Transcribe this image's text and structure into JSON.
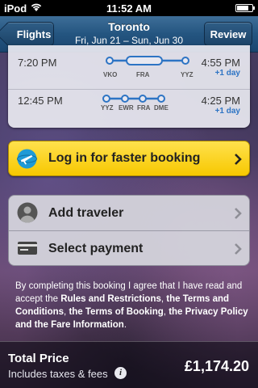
{
  "status_bar": {
    "carrier": "iPod",
    "time": "11:52 AM",
    "battery_level": 0.8
  },
  "nav": {
    "back_label": "Flights",
    "title": "Toronto",
    "subtitle": "Fri, Jun 21 – Sun, Jun 30",
    "review_label": "Review"
  },
  "flights": [
    {
      "departure": "7:20 PM",
      "arrival": "4:55 PM",
      "day_offset": "+1 day",
      "stops": [
        "VKO",
        "FRA",
        "YYZ"
      ]
    },
    {
      "departure": "12:45 PM",
      "arrival": "4:25 PM",
      "day_offset": "+1 day",
      "stops": [
        "YYZ",
        "EWR",
        "FRA",
        "DME"
      ]
    }
  ],
  "login_button": {
    "label": "Log in for faster booking",
    "icon": "globe-plane-icon"
  },
  "actions": {
    "add_traveler": "Add traveler",
    "select_payment": "Select payment"
  },
  "terms": {
    "prefix": "By completing this booking I agree that I have read and accept the ",
    "rules": "Rules and Restrictions",
    "sep1": ", ",
    "terms_conditions": "the Terms and Conditions",
    "sep2": ", ",
    "terms_booking": "the Terms of Booking",
    "sep3": ", ",
    "privacy_fare": "the Privacy Policy and the Fare Information",
    "suffix": "."
  },
  "footer": {
    "total_label": "Total Price",
    "includes": "Includes taxes & fees",
    "price": "£1,174.20"
  },
  "colors": {
    "nav_blue": "#245580",
    "accent_blue": "#2d74c4",
    "login_yellow": "#f7c800"
  }
}
